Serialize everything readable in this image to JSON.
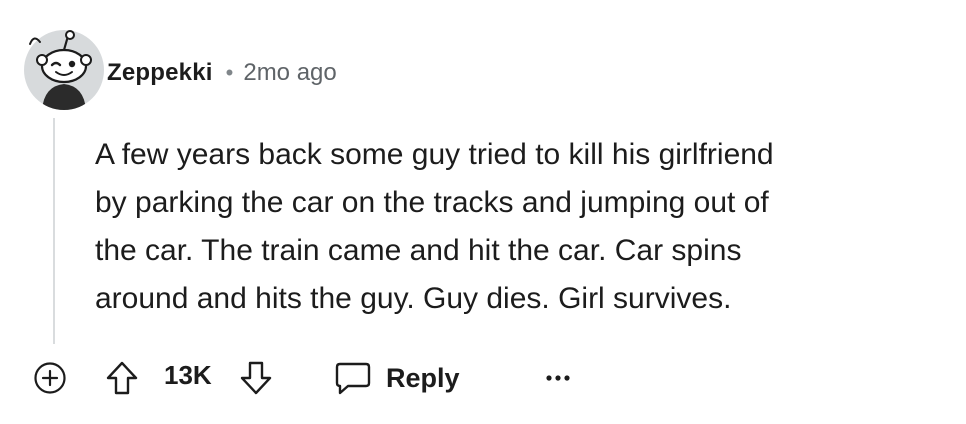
{
  "comment": {
    "author": "Zeppekki",
    "separator": "•",
    "timestamp": "2mo ago",
    "body_lines": [
      "A few years back some guy tried to kill his girlfriend",
      "by parking the car on the tracks and jumping out of",
      "the car. The train came and hit the car. Car spins",
      "around and hits the guy. Guy dies. Girl survives."
    ]
  },
  "actions": {
    "score": "13K",
    "reply_label": "Reply",
    "more_label": "···"
  },
  "icons": {
    "avatar": "snoo-avatar-icon",
    "expand": "plus-circle-icon",
    "upvote": "arrow-up-icon",
    "downvote": "arrow-down-icon",
    "reply": "speech-bubble-icon",
    "more": "ellipsis-icon"
  },
  "colors": {
    "text": "#1c1c1c",
    "muted": "#5f6468",
    "thread_line": "#d9dcde",
    "avatar_bg": "#d7dadc"
  }
}
